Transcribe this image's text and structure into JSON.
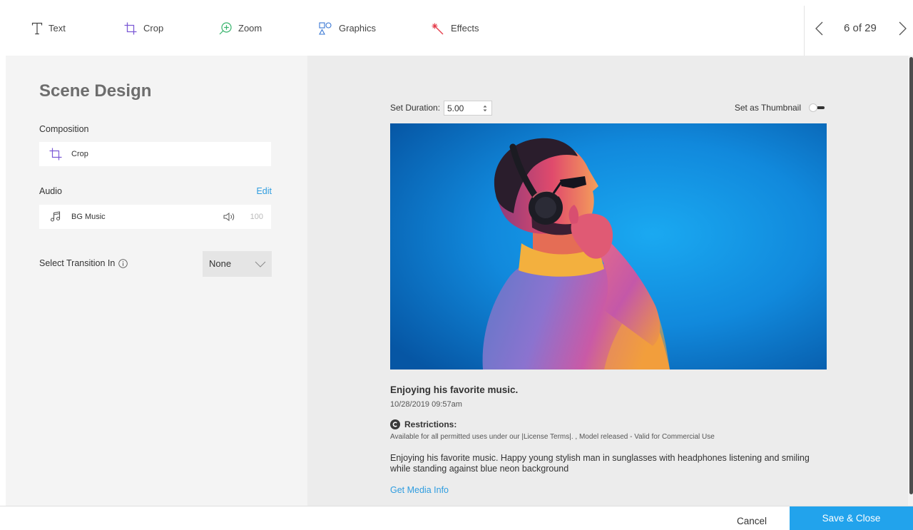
{
  "colors": {
    "accent": "#2f9de0",
    "save_button": "#22a3ec",
    "crop_icon": "#7c5ad5",
    "zoom_icon": "#37b36c",
    "graphics_icon": "#3a78d4",
    "effects_icon": "#e5414f",
    "sidebar_bg": "#f4f4f4",
    "stage_bg": "#ececec"
  },
  "toolbar": {
    "tools": [
      {
        "label": "Text",
        "icon": "text-icon"
      },
      {
        "label": "Crop",
        "icon": "crop-icon"
      },
      {
        "label": "Zoom",
        "icon": "zoom-in-icon"
      },
      {
        "label": "Graphics",
        "icon": "shapes-icon"
      },
      {
        "label": "Effects",
        "icon": "magic-wand-icon"
      }
    ],
    "pager": {
      "position": "6 of 29",
      "prev_icon": "chevron-left-icon",
      "next_icon": "chevron-right-icon"
    }
  },
  "sidebar": {
    "title": "Scene Design",
    "composition": {
      "label": "Composition",
      "item_label": "Crop",
      "item_icon": "crop-icon"
    },
    "audio": {
      "label": "Audio",
      "edit_label": "Edit",
      "item_label": "BG Music",
      "item_icon": "music-note-icon",
      "volume_icon": "speaker-icon",
      "volume": "100"
    },
    "transition": {
      "label": "Select Transition In",
      "info_icon": "info-icon",
      "selected": "None",
      "dropdown_icon": "chevron-down-icon"
    }
  },
  "main": {
    "duration": {
      "label": "Set Duration:",
      "value": "5.00"
    },
    "thumbnail": {
      "label": "Set as Thumbnail",
      "enabled": false
    },
    "media": {
      "title": "Enjoying his favorite music.",
      "date": "10/28/2019 09:57am",
      "restrictions_icon": "copyright-icon",
      "restrictions_label": "Restrictions:",
      "restrictions_text": "Available for all permitted uses under our |License Terms|. , Model released - Valid for Commercial Use",
      "description": "Enjoying his favorite music. Happy young stylish man in sunglasses with headphones listening and smiling while standing against blue neon background",
      "info_link": "Get Media Info"
    }
  },
  "footer": {
    "cancel_label": "Cancel",
    "save_label": "Save & Close"
  }
}
